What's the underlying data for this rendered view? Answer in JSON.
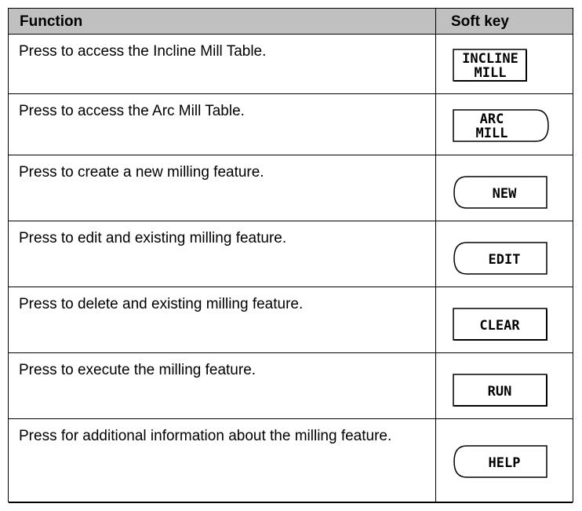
{
  "table": {
    "headers": {
      "function": "Function",
      "soft_key": "Soft key"
    },
    "rows": [
      {
        "description": "Press to access the Incline Mill Table.",
        "key_lines": [
          "INCLINE",
          "MILL"
        ],
        "key_shape": "rect"
      },
      {
        "description": "Press to access the Arc Mill Table.",
        "key_lines": [
          "ARC",
          "MILL"
        ],
        "key_shape": "right-rounded"
      },
      {
        "description": "Press to create a new milling feature.",
        "key_lines": [
          "NEW"
        ],
        "key_shape": "left-rounded"
      },
      {
        "description": "Press to edit and existing milling feature.",
        "key_lines": [
          "EDIT"
        ],
        "key_shape": "left-rounded"
      },
      {
        "description": "Press to delete and existing milling feature.",
        "key_lines": [
          "CLEAR"
        ],
        "key_shape": "rect"
      },
      {
        "description": "Press to execute the milling feature.",
        "key_lines": [
          "RUN"
        ],
        "key_shape": "rect"
      },
      {
        "description": "Press for additional information about the milling feature.",
        "key_lines": [
          "HELP"
        ],
        "key_shape": "left-rounded"
      }
    ]
  }
}
